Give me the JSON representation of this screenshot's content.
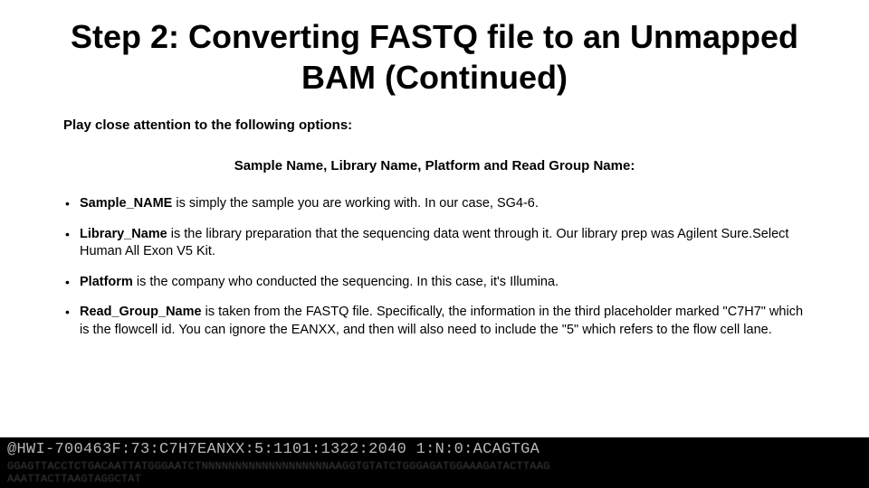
{
  "title": "Step 2:  Converting FASTQ file to an Unmapped BAM (Continued)",
  "intro": "Play close attention to the following options:",
  "subhead": "Sample Name, Library Name, Platform and Read Group Name:",
  "bullets": [
    {
      "term": "Sample_NAME",
      "text": " is simply the sample you are working with.  In our case, SG4-6."
    },
    {
      "term": "Library_Name",
      "text": " is the library preparation that the sequencing data went through it. Our library prep was Agilent Sure.Select Human All Exon V5 Kit."
    },
    {
      "term": "Platform",
      "text": " is the company who conducted the sequencing.  In this case, it's Illumina."
    },
    {
      "term": "Read_Group_Name",
      "text": " is taken from the FASTQ file.  Specifically, the information in the third placeholder marked \"C7H7\" which is the flowcell id.  You can ignore the EANXX, and then will also need to include the \"5\" which refers to the flow cell lane."
    }
  ],
  "code": {
    "line1": "@HWI-700463F:73:C7H7EANXX:5:1101:1322:2040 1:N:0:ACAGTGA",
    "line2": "GGAGTTACCTCTGACAATTATGGGAATCTNNNNNNNNNNNNNNNNNNNAAGGTGTATCTGGGAGATGGAAAGATACTTAAG",
    "line3": "AAATTACTTAAGTAGGCTAT"
  }
}
